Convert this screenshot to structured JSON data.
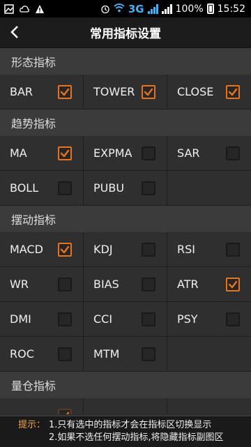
{
  "status_bar": {
    "network": "3G",
    "battery": "100%",
    "time": "15:52"
  },
  "title_bar": {
    "title": "常用指标设置"
  },
  "sections": [
    {
      "title": "形态指标",
      "items": [
        {
          "label": "BAR",
          "checked": true
        },
        {
          "label": "TOWER",
          "checked": true
        },
        {
          "label": "CLOSE",
          "checked": true
        }
      ]
    },
    {
      "title": "趋势指标",
      "items": [
        {
          "label": "MA",
          "checked": true
        },
        {
          "label": "EXPMA",
          "checked": false
        },
        {
          "label": "SAR",
          "checked": false
        },
        {
          "label": "BOLL",
          "checked": false
        },
        {
          "label": "PUBU",
          "checked": false
        }
      ]
    },
    {
      "title": "摆动指标",
      "items": [
        {
          "label": "MACD",
          "checked": true
        },
        {
          "label": "KDJ",
          "checked": false
        },
        {
          "label": "RSI",
          "checked": false
        },
        {
          "label": "WR",
          "checked": false
        },
        {
          "label": "BIAS",
          "checked": false
        },
        {
          "label": "ATR",
          "checked": true
        },
        {
          "label": "DMI",
          "checked": false
        },
        {
          "label": "CCI",
          "checked": false
        },
        {
          "label": "PSY",
          "checked": false
        },
        {
          "label": "ROC",
          "checked": false
        },
        {
          "label": "MTM",
          "checked": false
        }
      ]
    },
    {
      "title": "量仓指标",
      "items": [
        {
          "label": "",
          "checked": true
        }
      ]
    }
  ],
  "tip": {
    "label": "提示：",
    "line1": "1.只有选中的指标才会在指标区切换显示",
    "line2": "2.如果不选任何摆动指标,将隐藏指标副图区"
  },
  "colors": {
    "accent": "#e8731a",
    "tip_label": "#f5a43b",
    "signal": "#39b4ff"
  }
}
